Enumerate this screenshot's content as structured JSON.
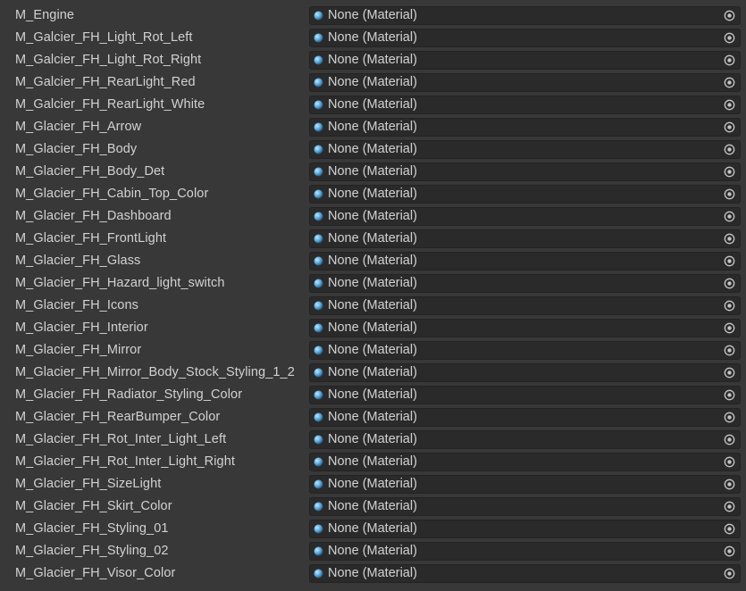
{
  "field_value": "None (Material)",
  "icons": {
    "material": "material-sphere-icon",
    "picker": "object-picker-icon"
  },
  "colors": {
    "background": "#383838",
    "field_background": "#2a2a2a",
    "text": "#d2d2d2",
    "material_icon": "#5aa7d9"
  },
  "rows": [
    {
      "label": "M_Engine",
      "value": "None (Material)"
    },
    {
      "label": "M_Galcier_FH_Light_Rot_Left",
      "value": "None (Material)"
    },
    {
      "label": "M_Galcier_FH_Light_Rot_Right",
      "value": "None (Material)"
    },
    {
      "label": "M_Galcier_FH_RearLight_Red",
      "value": "None (Material)"
    },
    {
      "label": "M_Galcier_FH_RearLight_White",
      "value": "None (Material)"
    },
    {
      "label": "M_Glacier_FH_Arrow",
      "value": "None (Material)"
    },
    {
      "label": "M_Glacier_FH_Body",
      "value": "None (Material)"
    },
    {
      "label": "M_Glacier_FH_Body_Det",
      "value": "None (Material)"
    },
    {
      "label": "M_Glacier_FH_Cabin_Top_Color",
      "value": "None (Material)"
    },
    {
      "label": "M_Glacier_FH_Dashboard",
      "value": "None (Material)"
    },
    {
      "label": "M_Glacier_FH_FrontLight",
      "value": "None (Material)"
    },
    {
      "label": "M_Glacier_FH_Glass",
      "value": "None (Material)"
    },
    {
      "label": "M_Glacier_FH_Hazard_light_switch",
      "value": "None (Material)"
    },
    {
      "label": "M_Glacier_FH_Icons",
      "value": "None (Material)"
    },
    {
      "label": "M_Glacier_FH_Interior",
      "value": "None (Material)"
    },
    {
      "label": "M_Glacier_FH_Mirror",
      "value": "None (Material)"
    },
    {
      "label": "M_Glacier_FH_Mirror_Body_Stock_Styling_1_2",
      "value": "None (Material)"
    },
    {
      "label": "M_Glacier_FH_Radiator_Styling_Color",
      "value": "None (Material)"
    },
    {
      "label": "M_Glacier_FH_RearBumper_Color",
      "value": "None (Material)"
    },
    {
      "label": "M_Glacier_FH_Rot_Inter_Light_Left",
      "value": "None (Material)"
    },
    {
      "label": "M_Glacier_FH_Rot_Inter_Light_Right",
      "value": "None (Material)"
    },
    {
      "label": "M_Glacier_FH_SizeLight",
      "value": "None (Material)"
    },
    {
      "label": "M_Glacier_FH_Skirt_Color",
      "value": "None (Material)"
    },
    {
      "label": "M_Glacier_FH_Styling_01",
      "value": "None (Material)"
    },
    {
      "label": "M_Glacier_FH_Styling_02",
      "value": "None (Material)"
    },
    {
      "label": "M_Glacier_FH_Visor_Color",
      "value": "None (Material)"
    }
  ]
}
